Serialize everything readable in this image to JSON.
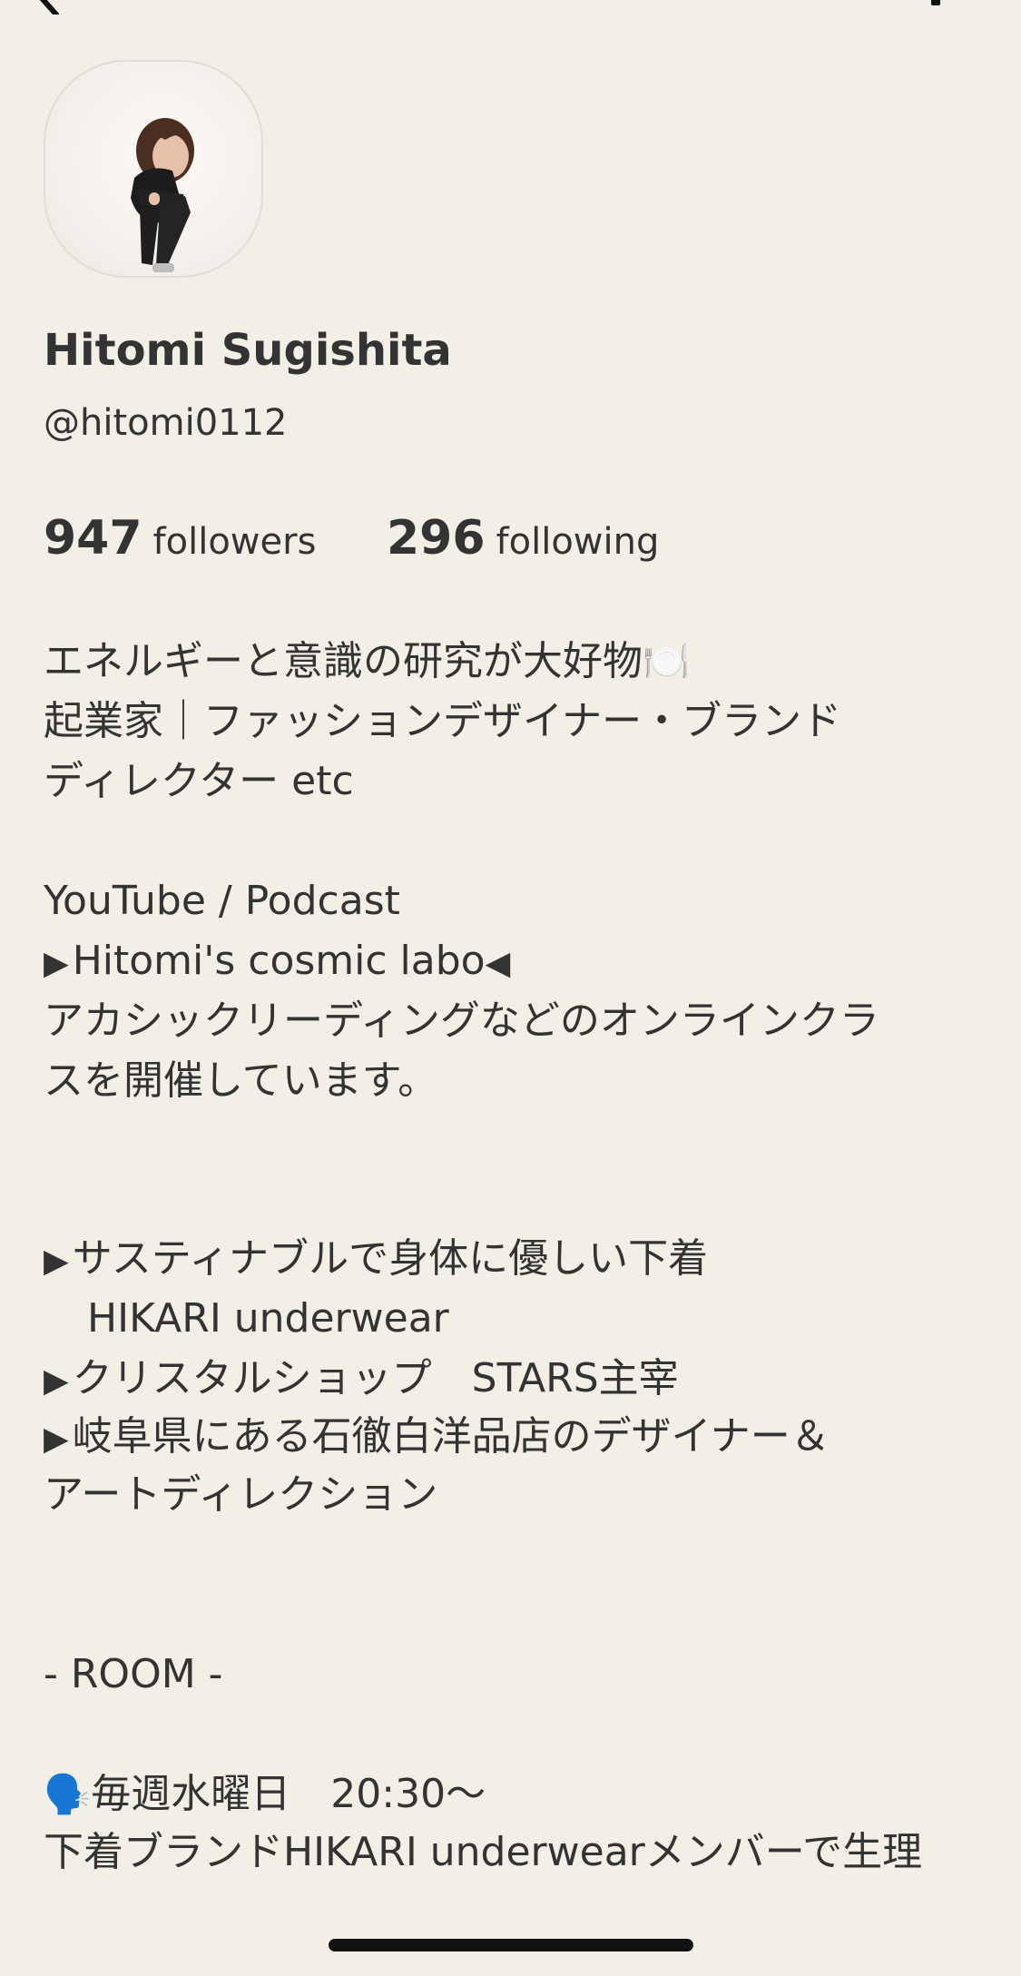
{
  "profile": {
    "name": "Hitomi Sugishita",
    "handle": "@hitomi0112",
    "followers_count": "947",
    "followers_label": "followers",
    "following_count": "296",
    "following_label": "following"
  },
  "bio": {
    "l1": "エネルギーと意識の研究が大好物",
    "l1_emoji": "🍽️",
    "l2": "起業家｜ファッションデザイナー・ブランド",
    "l3": "ディレクター etc",
    "l4": "YouTube / Podcast",
    "l5_pre": "▶",
    "l5": "Hitomi's cosmic labo",
    "l5_post": "◀",
    "l6": "アカシックリーディングなどのオンラインクラ",
    "l7": "スを開催しています。",
    "l8_pre": "▶",
    "l8": "サスティナブルで身体に優しい下着",
    "l9": "HIKARI underwear",
    "l10_pre": "▶",
    "l10": "クリスタルショップ　STARS主宰",
    "l11_pre": "▶",
    "l11": "岐阜県にある石徹白洋品店のデザイナー＆",
    "l12": "アートディレクション",
    "l13": "- ROOM -",
    "l14_emoji": "🗣️",
    "l14": "毎週水曜日　20:30〜",
    "l15": "下着ブランドHIKARI underwearメンバーで生理"
  },
  "icons": {
    "back": "chevron-left-icon",
    "settings": "gear-icon"
  },
  "colors": {
    "background": "#f2efe6",
    "text": "#333333",
    "avatar_border": "#e3ddd6"
  }
}
